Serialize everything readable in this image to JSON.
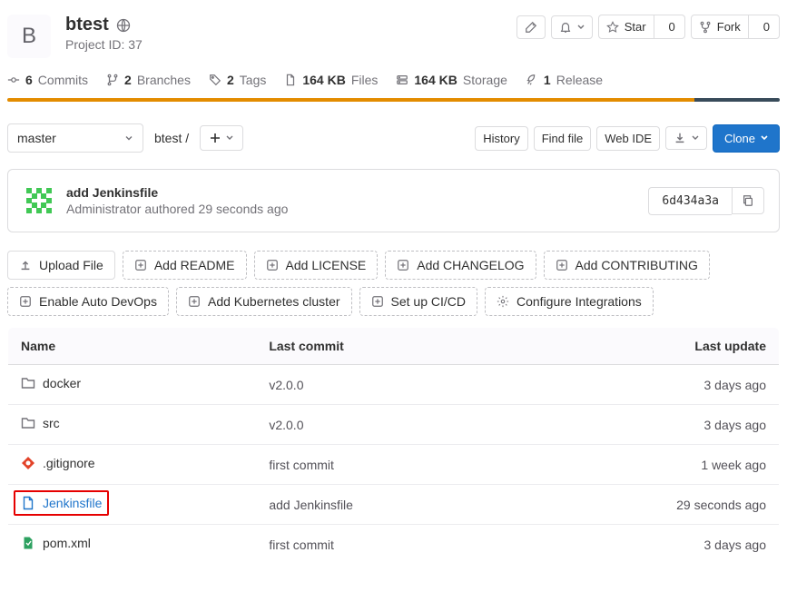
{
  "project": {
    "letter": "B",
    "name": "btest",
    "id_label": "Project ID: 37"
  },
  "actions": {
    "star_label": "Star",
    "star_count": "0",
    "fork_label": "Fork",
    "fork_count": "0"
  },
  "stats": {
    "commits_n": "6",
    "commits": "Commits",
    "branches_n": "2",
    "branches": "Branches",
    "tags_n": "2",
    "tags": "Tags",
    "files_n": "164 KB",
    "files": "Files",
    "storage_n": "164 KB",
    "storage": "Storage",
    "release_n": "1",
    "release": "Release"
  },
  "lang_bar": [
    {
      "color": "#E38C00",
      "pct": 89
    },
    {
      "color": "#384b5a",
      "pct": 11
    }
  ],
  "branch": "master",
  "breadcrumb": "btest",
  "controls": {
    "history": "History",
    "findfile": "Find file",
    "webide": "Web IDE",
    "clone": "Clone"
  },
  "last_commit": {
    "message": "add Jenkinsfile",
    "author": "Administrator",
    "authored": "authored",
    "time": "29 seconds ago",
    "sha": "6d434a3a"
  },
  "suggest_upload": "Upload File",
  "suggest1": [
    "Add README",
    "Add LICENSE",
    "Add CHANGELOG",
    "Add CONTRIBUTING"
  ],
  "suggest2": [
    {
      "icon": "plus-box",
      "label": "Enable Auto DevOps"
    },
    {
      "icon": "plus-box",
      "label": "Add Kubernetes cluster"
    },
    {
      "icon": "plus-box",
      "label": "Set up CI/CD"
    },
    {
      "icon": "gear",
      "label": "Configure Integrations"
    }
  ],
  "table_head": {
    "name": "Name",
    "commit": "Last commit",
    "update": "Last update"
  },
  "files": [
    {
      "type": "folder",
      "name": "docker",
      "commit": "v2.0.0",
      "update": "3 days ago"
    },
    {
      "type": "folder",
      "name": "src",
      "commit": "v2.0.0",
      "update": "3 days ago"
    },
    {
      "type": "gitignore",
      "name": ".gitignore",
      "commit": "first commit",
      "update": "1 week ago"
    },
    {
      "type": "file-blue",
      "name": "Jenkinsfile",
      "commit": "add Jenkinsfile",
      "update": "29 seconds ago",
      "highlight": true
    },
    {
      "type": "file-green",
      "name": "pom.xml",
      "commit": "first commit",
      "update": "3 days ago"
    }
  ]
}
